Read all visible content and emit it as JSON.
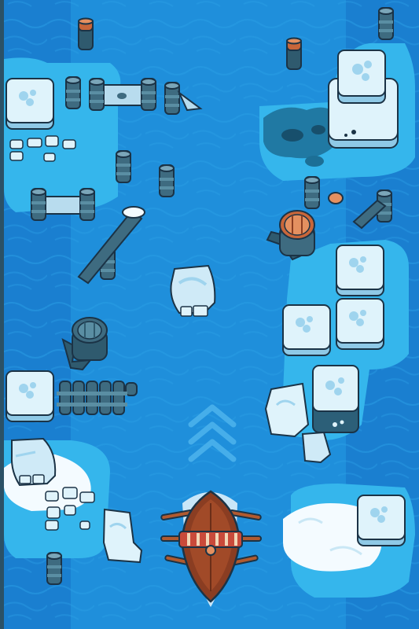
{
  "game": {
    "colors": {
      "deep_water": "#1a7fd0",
      "channel_water": "#1f8fdb",
      "shallow_water": "#35b6ec",
      "ice_top": "#dff3fb",
      "ice_side": "#8fc9e6",
      "outline": "#1b3346",
      "boat_wood": "#8a3d22",
      "boat_stripe_red": "#c94a3a",
      "boat_stripe_cream": "#f2d6b6"
    },
    "icons": {
      "boat": "rowing-boat-icon",
      "direction_hint": "triple-chevron-up-icon"
    }
  }
}
